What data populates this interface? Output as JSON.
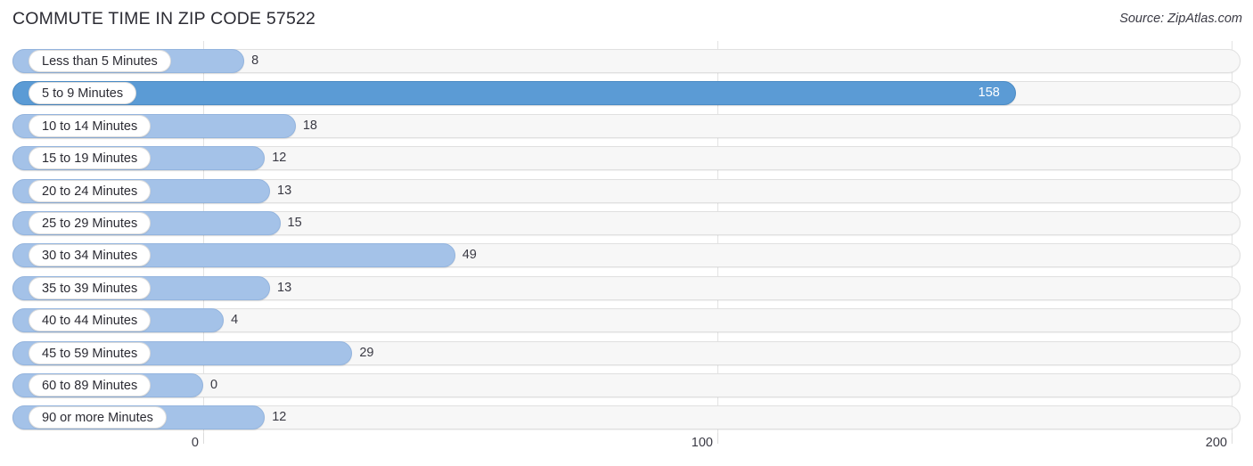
{
  "header": {
    "title": "COMMUTE TIME IN ZIP CODE 57522",
    "source": "Source: ZipAtlas.com"
  },
  "colors": {
    "bar": "#a4c2e8",
    "bar_highlight": "#5b9bd5",
    "track": "#f7f7f7",
    "grid": "#e3e3e3",
    "text": "#2b2b33"
  },
  "chart_data": {
    "type": "bar",
    "orientation": "horizontal",
    "title": "COMMUTE TIME IN ZIP CODE 57522",
    "xlabel": "",
    "ylabel": "",
    "xlim": [
      0,
      200
    ],
    "grid": true,
    "legend": false,
    "source": "Source: ZipAtlas.com",
    "xticks": [
      "0",
      "100",
      "200"
    ],
    "xtick_values": [
      0,
      100,
      200
    ],
    "categories": [
      "Less than 5 Minutes",
      "5 to 9 Minutes",
      "10 to 14 Minutes",
      "15 to 19 Minutes",
      "20 to 24 Minutes",
      "25 to 29 Minutes",
      "30 to 34 Minutes",
      "35 to 39 Minutes",
      "40 to 44 Minutes",
      "45 to 59 Minutes",
      "60 to 89 Minutes",
      "90 or more Minutes"
    ],
    "values": [
      8,
      158,
      18,
      12,
      13,
      15,
      49,
      13,
      4,
      29,
      0,
      12
    ],
    "value_labels": [
      "8",
      "158",
      "18",
      "12",
      "13",
      "15",
      "49",
      "13",
      "4",
      "29",
      "0",
      "12"
    ],
    "highlight_index": 1
  }
}
